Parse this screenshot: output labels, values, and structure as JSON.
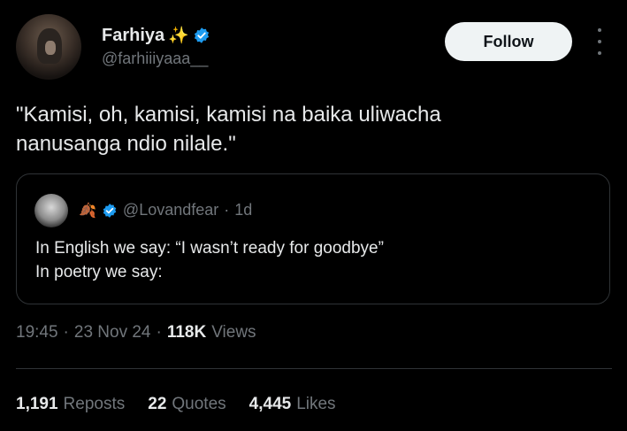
{
  "author": {
    "display_name": "Farhiya",
    "emoji": "✨",
    "handle": "@farhiiiyaaa__"
  },
  "follow_label": "Follow",
  "tweet": {
    "text": "\"Kamisi, oh, kamisi, kamisi na baika uliwacha\nnanusanga ndio nilale.\""
  },
  "quote": {
    "name_emoji": "🍂",
    "handle": "@Lovandfear",
    "age": "1d",
    "line1": "In English we say: “I wasn’t ready for goodbye”",
    "line2": "In poetry we say:"
  },
  "meta": {
    "time": "19:45",
    "date": "23 Nov 24",
    "views_count": "118K",
    "views_label": "Views"
  },
  "stats": {
    "reposts_count": "1,191",
    "reposts_label": "Reposts",
    "quotes_count": "22",
    "quotes_label": "Quotes",
    "likes_count": "4,445",
    "likes_label": "Likes"
  },
  "colors": {
    "background": "#000000",
    "verified": "#1d9bf0",
    "secondary_text": "#71767b"
  }
}
